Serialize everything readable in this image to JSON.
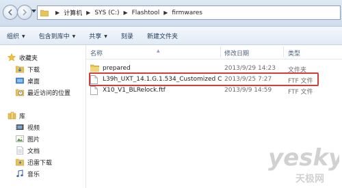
{
  "address_bar": {
    "breadcrumbs": [
      "计算机",
      "SYS (C:)",
      "Flashtool",
      "firmwares"
    ]
  },
  "toolbar": {
    "organize": "组织",
    "include_in_library": "包含到库中",
    "share": "共享",
    "burn": "刻录",
    "new_folder": "新建文件夹"
  },
  "nav": {
    "favorites": "收藏夹",
    "downloads": "下载",
    "desktop": "桌面",
    "recent": "最近访问的位置",
    "libraries": "库",
    "videos": "视频",
    "pictures": "图片",
    "documents": "文档",
    "thunder": "迅雷下载",
    "music": "音乐"
  },
  "columns": {
    "name": "名称",
    "modified": "修改日期",
    "type": "类型"
  },
  "files": [
    {
      "name": "prepared",
      "modified": "2013/9/29 14:23",
      "type": "文件夹",
      "icon": "folder-icon"
    },
    {
      "name": "L39h_UXT_14.1.G.1.534_Customized C...",
      "modified": "2013/9/25 7:27",
      "type": "FTF 文件",
      "icon": "file-icon"
    },
    {
      "name": "X10_V1_BLRelock.ftf",
      "modified": "2013/9/9 14:59",
      "type": "FTF 文件",
      "icon": "file-icon"
    }
  ],
  "watermark": {
    "logo": "yesky",
    "sub": "天极网"
  },
  "colors": {
    "highlight": "#d43b3b",
    "folder": "#e8c35a"
  }
}
